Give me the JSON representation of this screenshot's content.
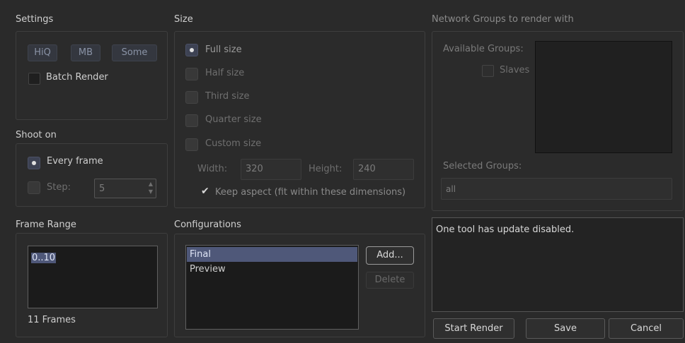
{
  "settings": {
    "title": "Settings",
    "buttons": [
      "HiQ",
      "MB",
      "Some"
    ],
    "batch_render": "Batch Render"
  },
  "shoot_on": {
    "title": "Shoot on",
    "every_frame": "Every frame",
    "step_label": "Step:",
    "step_value": "5"
  },
  "frame_range": {
    "title": "Frame Range",
    "value": "0..10",
    "count": "11 Frames"
  },
  "size": {
    "title": "Size",
    "options": [
      "Full size",
      "Half size",
      "Third size",
      "Quarter size",
      "Custom size"
    ],
    "selected": "Full size",
    "width_label": "Width:",
    "width_value": "320",
    "height_label": "Height:",
    "height_value": "240",
    "keep_aspect": "Keep aspect (fit within these dimensions)"
  },
  "configurations": {
    "title": "Configurations",
    "items": [
      "Final",
      "Preview"
    ],
    "selected": "Final",
    "add": "Add...",
    "delete": "Delete"
  },
  "network": {
    "title": "Network Groups to render with",
    "available_label": "Available Groups:",
    "slaves": "Slaves",
    "selected_label": "Selected Groups:",
    "selected_value": "all"
  },
  "message": "One tool has update disabled.",
  "actions": {
    "start_render": "Start Render",
    "save": "Save",
    "cancel": "Cancel"
  },
  "icons": {
    "checkmark": "checkmark-icon",
    "spin_up": "spin-up-icon",
    "spin_down": "spin-down-icon"
  }
}
